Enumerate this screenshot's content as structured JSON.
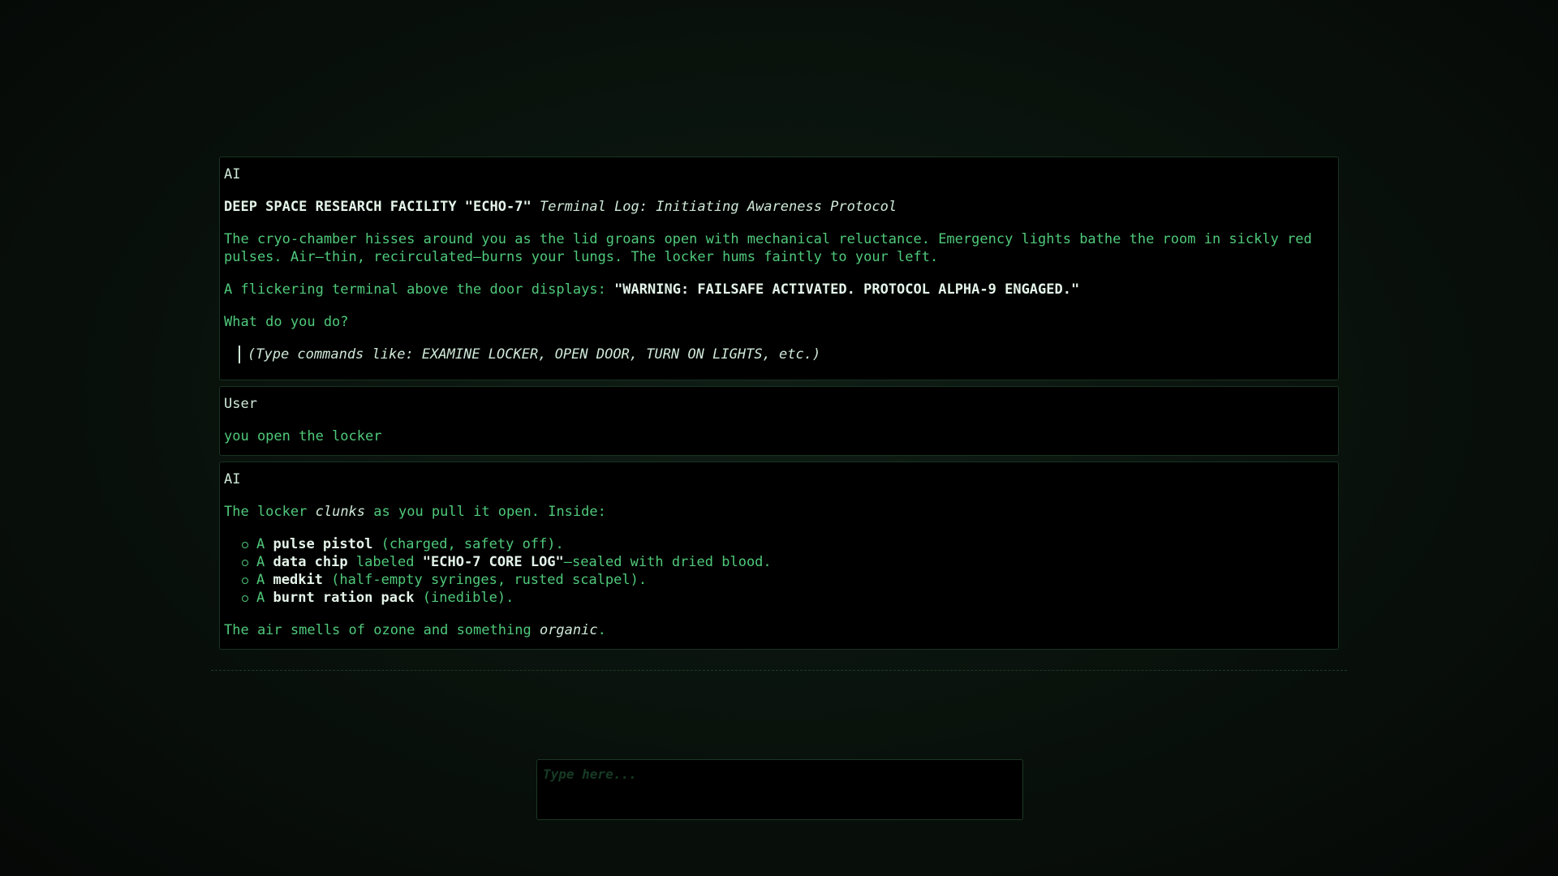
{
  "messages": [
    {
      "sender": "AI",
      "title_bold": "DEEP SPACE RESEARCH FACILITY \"ECHO-7\"",
      "title_italic": "Terminal Log: Initiating Awareness Protocol",
      "para1": "The cryo-chamber hisses around you as the lid groans open with mechanical reluctance. Emergency lights bathe the room in sickly red pulses. Air—thin, recirculated—burns your lungs. The locker hums faintly to your left.",
      "para2_prefix": "A flickering terminal above the door displays:",
      "para2_bold": "\"WARNING: FAILSAFE ACTIVATED. PROTOCOL ALPHA-9 ENGAGED.\"",
      "question": "What do you do?",
      "hint": "(Type commands like: EXAMINE LOCKER, OPEN DOOR, TURN ON LIGHTS, etc.)"
    },
    {
      "sender": "User",
      "text": "you open the locker"
    },
    {
      "sender": "AI",
      "intro_a": "The locker",
      "intro_italic": "clunks",
      "intro_b": "as you pull it open. Inside:",
      "items": [
        {
          "prefix": "A",
          "bold": "pulse pistol",
          "rest": "(charged, safety off)."
        },
        {
          "prefix": "A",
          "bold": "data chip",
          "mid": "labeled",
          "bold2": "\"ECHO-7 CORE LOG\"",
          "rest": "—sealed with dried blood."
        },
        {
          "prefix": "A",
          "bold": "medkit",
          "rest": "(half-empty syringes, rusted scalpel)."
        },
        {
          "prefix": "A",
          "bold": "burnt ration pack",
          "rest": "(inedible)."
        }
      ],
      "outro_a": "The air smells of ozone and something",
      "outro_italic": "organic",
      "outro_b": "."
    }
  ],
  "input": {
    "placeholder": "Type here..."
  },
  "colors": {
    "background": "#0a130d",
    "text_green": "#4fc97a",
    "text_bright": "#e4f4e9",
    "panel": "#000000"
  }
}
